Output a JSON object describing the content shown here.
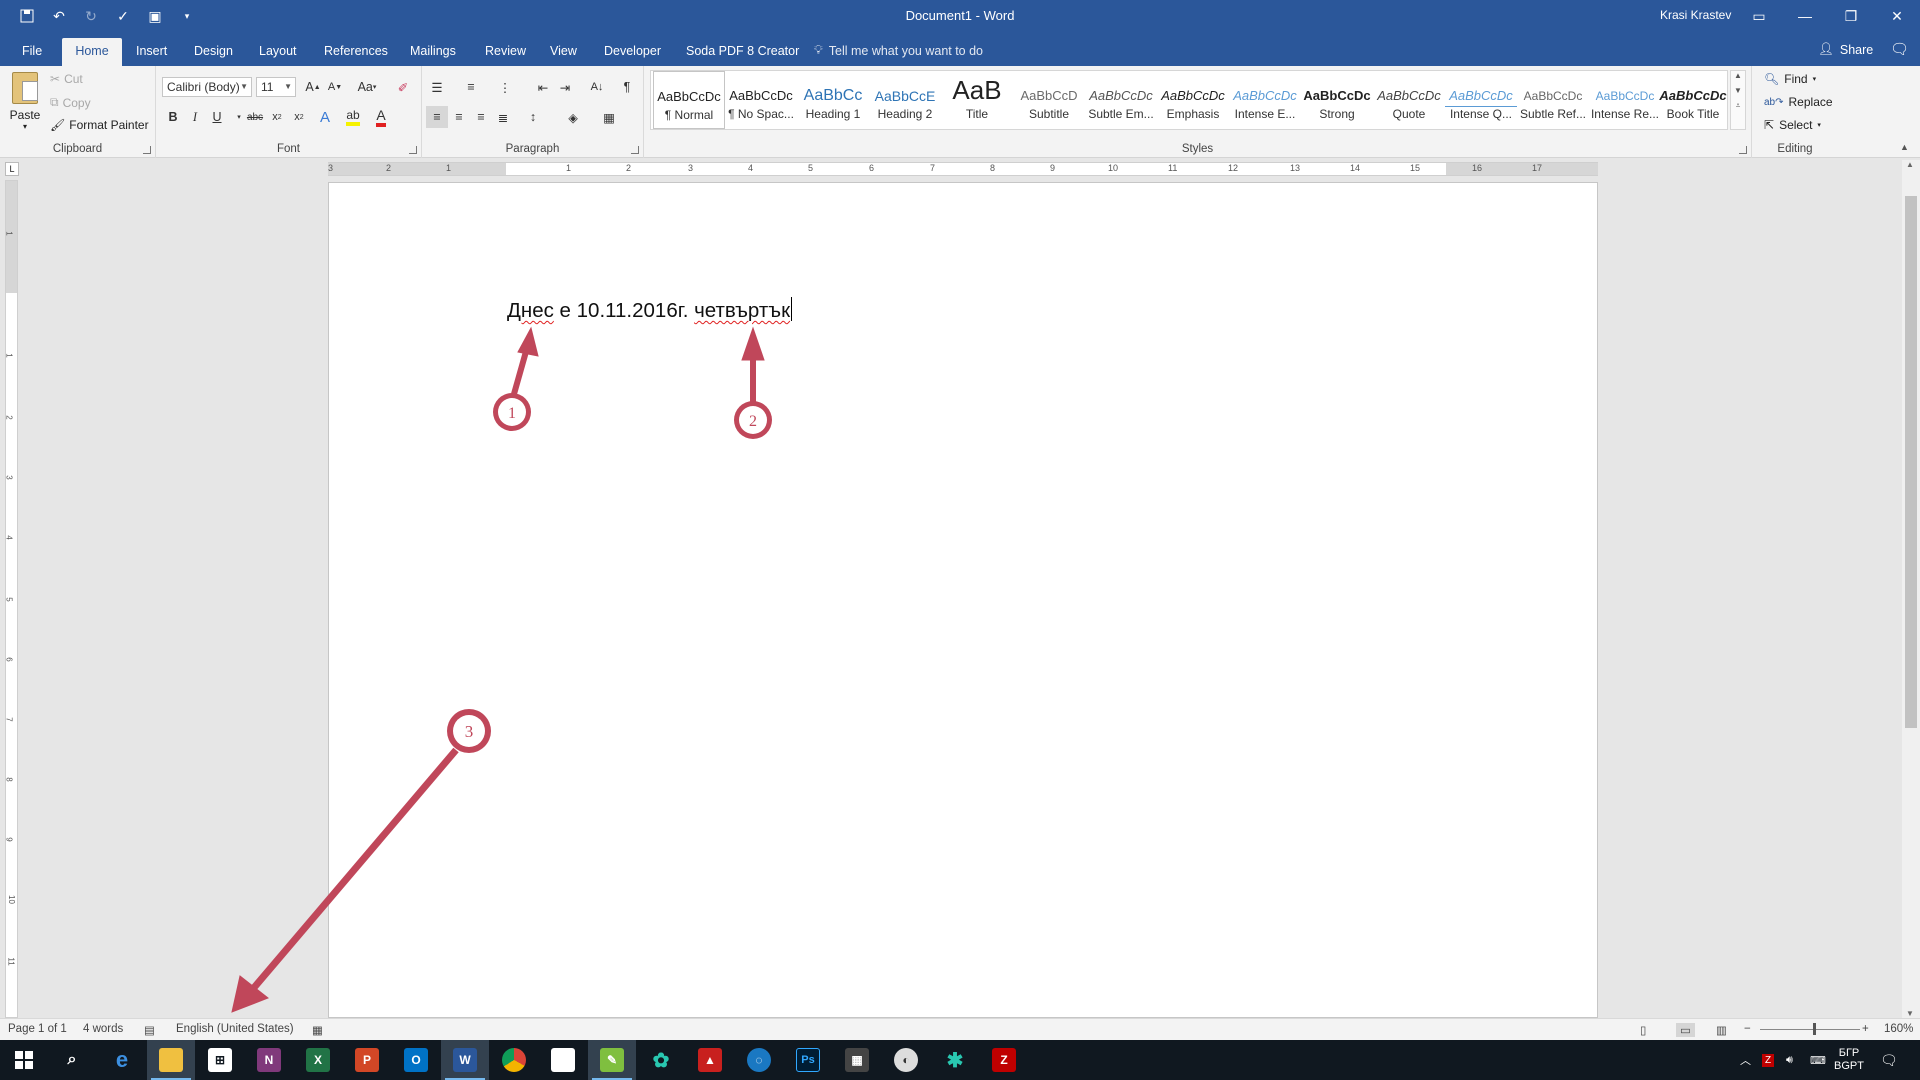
{
  "window": {
    "title": "Document1 - Word",
    "user": "Krasi Krastev"
  },
  "tabs": [
    "File",
    "Home",
    "Insert",
    "Design",
    "Layout",
    "References",
    "Mailings",
    "Review",
    "View",
    "Developer",
    "Soda PDF 8 Creator"
  ],
  "active_tab": "Home",
  "tell_me": "Tell me what you want to do",
  "share_label": "Share",
  "clipboard": {
    "paste": "Paste",
    "cut": "Cut",
    "copy": "Copy",
    "format_painter": "Format Painter",
    "label": "Clipboard"
  },
  "font": {
    "name": "Calibri (Body)",
    "size": "11",
    "label": "Font",
    "change_case": "Aa"
  },
  "paragraph": {
    "label": "Paragraph"
  },
  "styles": {
    "label": "Styles",
    "items": [
      {
        "preview": "AaBbCcDc",
        "name": "¶ Normal"
      },
      {
        "preview": "AaBbCcDc",
        "name": "¶ No Spac..."
      },
      {
        "preview": "AaBbCc",
        "name": "Heading 1"
      },
      {
        "preview": "AaBbCcE",
        "name": "Heading 2"
      },
      {
        "preview": "AaB",
        "name": "Title"
      },
      {
        "preview": "AaBbCcD",
        "name": "Subtitle"
      },
      {
        "preview": "AaBbCcDc",
        "name": "Subtle Em..."
      },
      {
        "preview": "AaBbCcDc",
        "name": "Emphasis"
      },
      {
        "preview": "AaBbCcDc",
        "name": "Intense E..."
      },
      {
        "preview": "AaBbCcDc",
        "name": "Strong"
      },
      {
        "preview": "AaBbCcDc",
        "name": "Quote"
      },
      {
        "preview": "AaBbCcDc",
        "name": "Intense Q..."
      },
      {
        "preview": "AaBbCcDc",
        "name": "Subtle Ref..."
      },
      {
        "preview": "AaBbCcDc",
        "name": "Intense Re..."
      },
      {
        "preview": "AaBbCcDc",
        "name": "Book Title"
      }
    ]
  },
  "editing": {
    "label": "Editing",
    "find": "Find",
    "replace": "Replace",
    "select": "Select"
  },
  "ruler_numbers": [
    "3",
    "2",
    "1",
    "1",
    "2",
    "3",
    "4",
    "5",
    "6",
    "7",
    "8",
    "9",
    "10",
    "11",
    "12",
    "13",
    "14",
    "15",
    "16",
    "17"
  ],
  "vruler_numbers": [
    "1",
    "1",
    "2",
    "3",
    "4",
    "5",
    "6",
    "7",
    "8",
    "9",
    "10",
    "11"
  ],
  "document": {
    "word1": "Днес",
    "middle": " е 10.11.2016г. ",
    "word2": "четвъртък"
  },
  "annotations": [
    "1",
    "2",
    "3"
  ],
  "status": {
    "page": "Page 1 of 1",
    "words": "4 words",
    "language": "English (United States)",
    "zoom": "160%"
  },
  "tray": {
    "lang": "БГР",
    "layout": "BGPT"
  },
  "colors": {
    "brand": "#2b579a",
    "annotation": "#c0475a",
    "spell_error": "#e02020"
  }
}
